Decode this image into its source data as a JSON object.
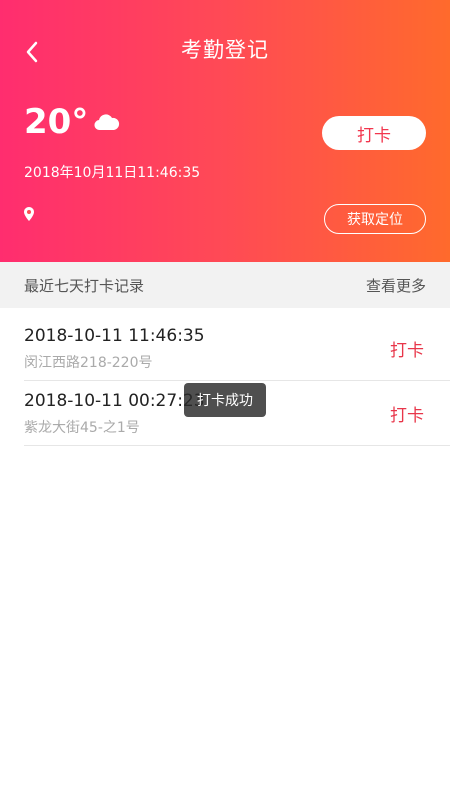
{
  "header": {
    "title": "考勤登记",
    "temperature": "20°",
    "weather_icon": "cloud-icon",
    "datetime": "2018年10月11日11:46:35",
    "punch_label": "打卡",
    "locate_label": "获取定位",
    "location_text": ""
  },
  "records_section": {
    "title": "最近七天打卡记录",
    "more_label": "查看更多"
  },
  "records": [
    {
      "time": "2018-10-11 11:46:35",
      "address": "闵江西路218-220号",
      "action": "打卡"
    },
    {
      "time": "2018-10-11 00:27:23",
      "address": "紫龙大街45-之1号",
      "action": "打卡"
    }
  ],
  "toast": {
    "text": "打卡成功"
  },
  "colors": {
    "gradient_start": "#ff2d6f",
    "gradient_end": "#ff6a2c",
    "accent": "#e8364a"
  }
}
